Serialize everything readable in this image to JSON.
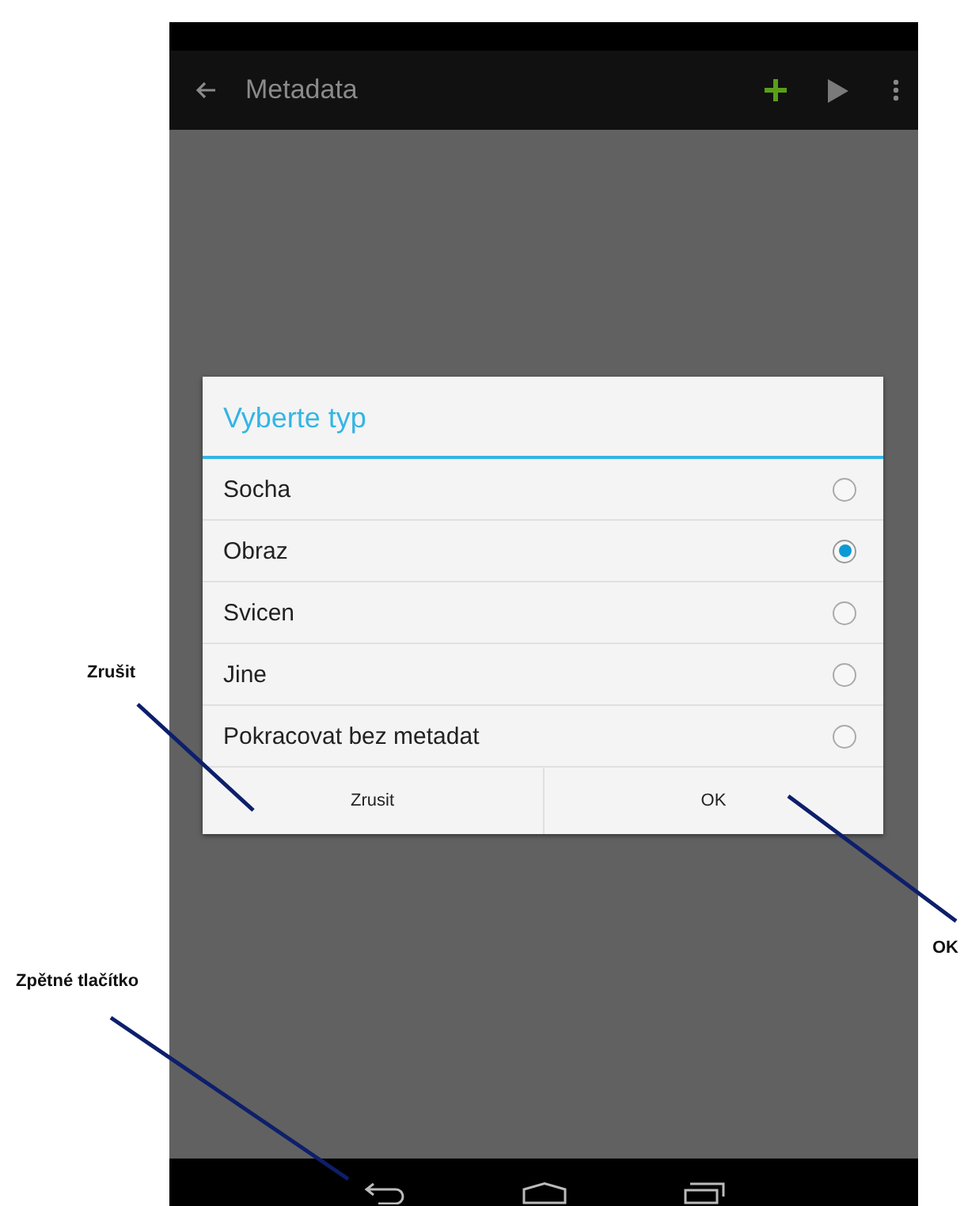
{
  "action_bar": {
    "title": "Metadata"
  },
  "dialog": {
    "title": "Vyberte typ",
    "options": [
      {
        "label": "Socha",
        "selected": false
      },
      {
        "label": "Obraz",
        "selected": true
      },
      {
        "label": "Svicen",
        "selected": false
      },
      {
        "label": "Jine",
        "selected": false
      },
      {
        "label": "Pokracovat bez metadat",
        "selected": false
      }
    ],
    "buttons": [
      "Zrusit",
      "OK"
    ]
  },
  "annotations": [
    {
      "label": "Zrušit"
    },
    {
      "label": "Zpětné tlačítko"
    },
    {
      "label": "OK"
    }
  ]
}
